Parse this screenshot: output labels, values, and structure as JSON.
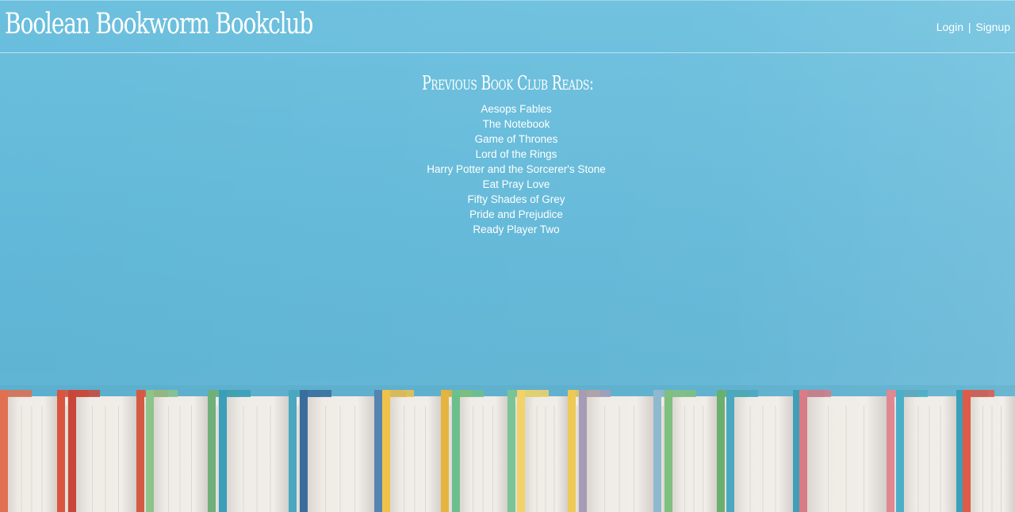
{
  "header": {
    "site_title": "Boolean Bookworm Bookclub",
    "login_label": "Login",
    "separator": "|",
    "signup_label": "Signup"
  },
  "main": {
    "heading": "Previous Book Club Reads:",
    "books": [
      "Aesops Fables",
      "The Notebook",
      "Game of Thrones",
      "Lord of the Rings",
      "Harry Potter and the Sorcerer's Stone",
      "Eat Pray Love",
      "Fifty Shades of Grey",
      "Pride and Prejudice",
      "Ready Player Two"
    ]
  },
  "background": {
    "description_icon": "books-row-photo",
    "sky_color": "#66bcdb",
    "page_color": "#ece8e3"
  }
}
